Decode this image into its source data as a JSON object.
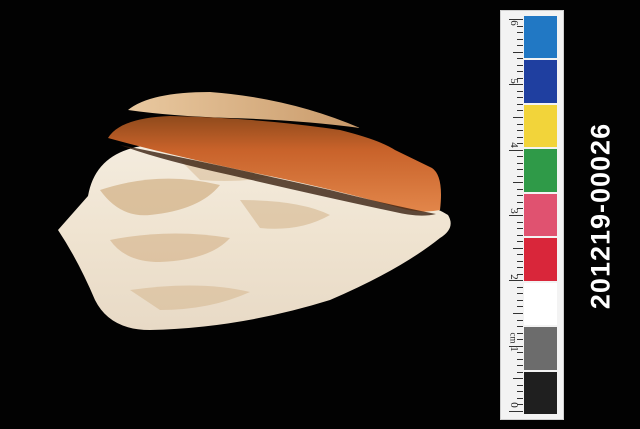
{
  "catalog_number": "201219-00026",
  "scale": {
    "unit": "cm",
    "numbers": [
      "0",
      "1",
      "2",
      "3",
      "4",
      "5",
      "6"
    ],
    "swatches": [
      "#1f1f1f",
      "#6c6c6c",
      "#ffffff",
      "#d9263a",
      "#e05270",
      "#2f9a48",
      "#f2d43a",
      "#1f3fa0",
      "#2178c4"
    ]
  },
  "colors": {
    "background": "#020202",
    "shell_body": "#efe4d3",
    "shell_pattern": "#c9a06e",
    "aperture": "#c05a22"
  }
}
